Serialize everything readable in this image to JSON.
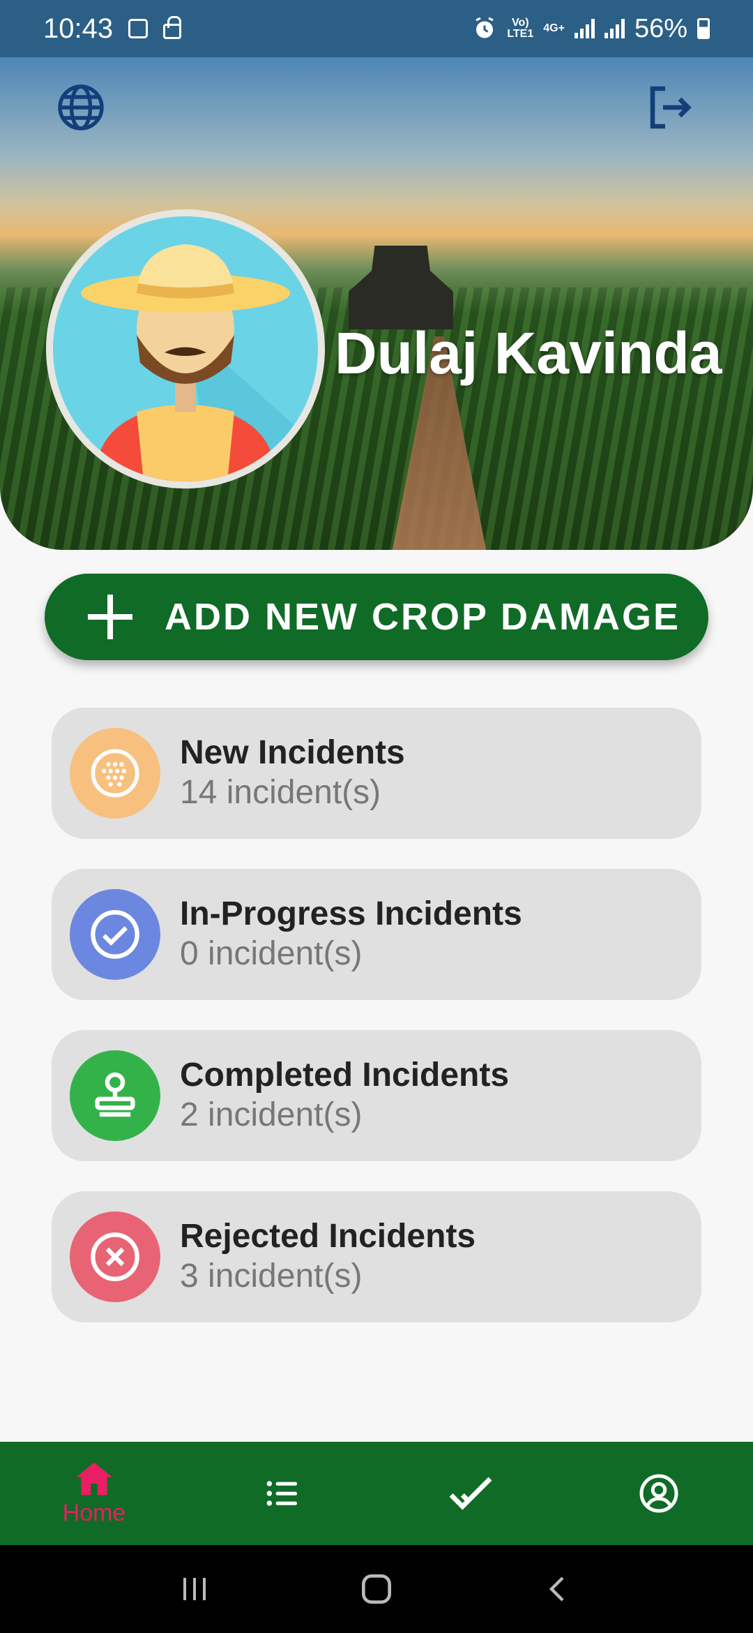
{
  "status_bar": {
    "time": "10:43",
    "network_top": "Vo)",
    "network_bottom": "LTE1",
    "data_type": "4G+",
    "battery": "56%"
  },
  "header": {
    "user_name": "Dulaj Kavinda"
  },
  "actions": {
    "add_crop_damage_label": "ADD NEW CROP DAMAGE"
  },
  "cards": [
    {
      "title": "New Incidents",
      "count": "14 incident(s)",
      "color": "#f8c07e",
      "icon": "grid-circle-icon"
    },
    {
      "title": "In-Progress Incidents",
      "count": "0 incident(s)",
      "color": "#6b87e0",
      "icon": "check-circle-icon"
    },
    {
      "title": "Completed Incidents",
      "count": "2 incident(s)",
      "color": "#33b24a",
      "icon": "stamp-icon"
    },
    {
      "title": "Rejected Incidents",
      "count": "3 incident(s)",
      "color": "#e86474",
      "icon": "x-circle-icon"
    }
  ],
  "bottom_nav": {
    "home_label": "Home",
    "active_color": "#e91e63",
    "items": [
      "home-icon",
      "list-icon",
      "check-icon",
      "account-icon"
    ]
  },
  "colors": {
    "primary": "#0f6b26",
    "status_bar": "#2c5f86",
    "card_bg": "#e0e0e0"
  }
}
